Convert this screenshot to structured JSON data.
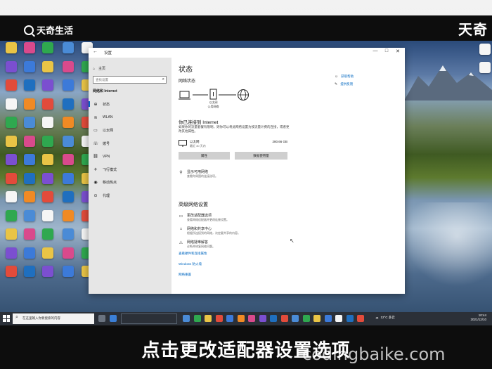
{
  "overlay": {
    "logo_left": "天奇生活",
    "logo_right": "天奇",
    "subtitle": "点击更改适配器设置选项",
    "watermark": "codingbaike.com"
  },
  "desktop_icons": [
    {
      "label": "",
      "color": "#e9c446"
    },
    {
      "label": "",
      "color": "#4a8bd6"
    },
    {
      "label": "",
      "color": "#e24b3b"
    },
    {
      "label": "",
      "color": "#4a8bd6"
    },
    {
      "label": "",
      "color": "#3c7ad9"
    }
  ],
  "window": {
    "title": "设置",
    "controls": {
      "minimize": "—",
      "maximize": "□",
      "close": "✕"
    }
  },
  "sidebar": {
    "home": "主页",
    "search_placeholder": "查找设置",
    "section": "网络和 Internet",
    "items": [
      {
        "icon": "globe-icon",
        "glyph": "⊕",
        "label": "状态"
      },
      {
        "icon": "wifi-icon",
        "glyph": "≋",
        "label": "WLAN"
      },
      {
        "icon": "ethernet-icon",
        "glyph": "▭",
        "label": "以太网"
      },
      {
        "icon": "dialup-icon",
        "glyph": "☏",
        "label": "拨号"
      },
      {
        "icon": "vpn-icon",
        "glyph": "⛓",
        "label": "VPN"
      },
      {
        "icon": "airplane-icon",
        "glyph": "✈",
        "label": "飞行模式"
      },
      {
        "icon": "hotspot-icon",
        "glyph": "◉",
        "label": "移动热点"
      },
      {
        "icon": "proxy-icon",
        "glyph": "⊙",
        "label": "代理"
      }
    ]
  },
  "main": {
    "title": "状态",
    "net_status_heading": "网络状态",
    "diagram": {
      "ethernet_label": "以太网",
      "network_label": "公用网络"
    },
    "connected_title": "你已连接到 Internet",
    "connected_desc": "如果你的流量套餐有限制，则你可以将此网络设置为按流量计费的连接，或者更改其他属性。",
    "ethernet": {
      "name": "以太网",
      "sub": "最近 30 天内",
      "size": "280.66 GB"
    },
    "btn_properties": "属性",
    "btn_usage": "数据使用量",
    "show_networks": {
      "title": "显示可用网络",
      "desc": "查看你周围的连接选项。"
    },
    "advanced_heading": "高级网络设置",
    "adv_items": [
      {
        "icon": "adapter-icon",
        "glyph": "▭",
        "title": "更改适配器选项",
        "desc": "查看网络适配器并更改连接设置。"
      },
      {
        "icon": "sharing-icon",
        "glyph": "⌂",
        "title": "网络和共享中心",
        "desc": "根据所连接到的网络，决定要共享的内容。"
      },
      {
        "icon": "troubleshoot-icon",
        "glyph": "⚠",
        "title": "网络疑难解答",
        "desc": "诊断并修复网络问题。"
      }
    ],
    "links": [
      "查看硬件和连接属性",
      "Windows 防火墙",
      "网络重置"
    ],
    "help": {
      "get_help": "获取帮助",
      "feedback": "提供反馈"
    }
  },
  "taskbar": {
    "search_text": "在这里输入你要搜索的内容",
    "weather": "12°C 多云",
    "time": "10:44",
    "date": "2021/12/10"
  }
}
